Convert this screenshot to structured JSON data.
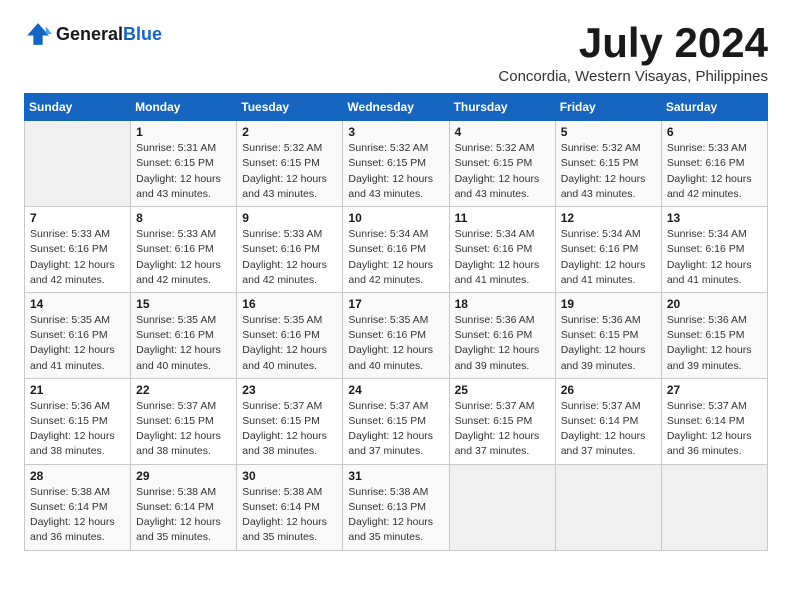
{
  "header": {
    "logo_general": "General",
    "logo_blue": "Blue",
    "month_year": "July 2024",
    "location": "Concordia, Western Visayas, Philippines"
  },
  "days_of_week": [
    "Sunday",
    "Monday",
    "Tuesday",
    "Wednesday",
    "Thursday",
    "Friday",
    "Saturday"
  ],
  "weeks": [
    [
      {
        "day": "",
        "sunrise": "",
        "sunset": "",
        "daylight": ""
      },
      {
        "day": "1",
        "sunrise": "Sunrise: 5:31 AM",
        "sunset": "Sunset: 6:15 PM",
        "daylight": "Daylight: 12 hours and 43 minutes."
      },
      {
        "day": "2",
        "sunrise": "Sunrise: 5:32 AM",
        "sunset": "Sunset: 6:15 PM",
        "daylight": "Daylight: 12 hours and 43 minutes."
      },
      {
        "day": "3",
        "sunrise": "Sunrise: 5:32 AM",
        "sunset": "Sunset: 6:15 PM",
        "daylight": "Daylight: 12 hours and 43 minutes."
      },
      {
        "day": "4",
        "sunrise": "Sunrise: 5:32 AM",
        "sunset": "Sunset: 6:15 PM",
        "daylight": "Daylight: 12 hours and 43 minutes."
      },
      {
        "day": "5",
        "sunrise": "Sunrise: 5:32 AM",
        "sunset": "Sunset: 6:15 PM",
        "daylight": "Daylight: 12 hours and 43 minutes."
      },
      {
        "day": "6",
        "sunrise": "Sunrise: 5:33 AM",
        "sunset": "Sunset: 6:16 PM",
        "daylight": "Daylight: 12 hours and 42 minutes."
      }
    ],
    [
      {
        "day": "7",
        "sunrise": "Sunrise: 5:33 AM",
        "sunset": "Sunset: 6:16 PM",
        "daylight": "Daylight: 12 hours and 42 minutes."
      },
      {
        "day": "8",
        "sunrise": "Sunrise: 5:33 AM",
        "sunset": "Sunset: 6:16 PM",
        "daylight": "Daylight: 12 hours and 42 minutes."
      },
      {
        "day": "9",
        "sunrise": "Sunrise: 5:33 AM",
        "sunset": "Sunset: 6:16 PM",
        "daylight": "Daylight: 12 hours and 42 minutes."
      },
      {
        "day": "10",
        "sunrise": "Sunrise: 5:34 AM",
        "sunset": "Sunset: 6:16 PM",
        "daylight": "Daylight: 12 hours and 42 minutes."
      },
      {
        "day": "11",
        "sunrise": "Sunrise: 5:34 AM",
        "sunset": "Sunset: 6:16 PM",
        "daylight": "Daylight: 12 hours and 41 minutes."
      },
      {
        "day": "12",
        "sunrise": "Sunrise: 5:34 AM",
        "sunset": "Sunset: 6:16 PM",
        "daylight": "Daylight: 12 hours and 41 minutes."
      },
      {
        "day": "13",
        "sunrise": "Sunrise: 5:34 AM",
        "sunset": "Sunset: 6:16 PM",
        "daylight": "Daylight: 12 hours and 41 minutes."
      }
    ],
    [
      {
        "day": "14",
        "sunrise": "Sunrise: 5:35 AM",
        "sunset": "Sunset: 6:16 PM",
        "daylight": "Daylight: 12 hours and 41 minutes."
      },
      {
        "day": "15",
        "sunrise": "Sunrise: 5:35 AM",
        "sunset": "Sunset: 6:16 PM",
        "daylight": "Daylight: 12 hours and 40 minutes."
      },
      {
        "day": "16",
        "sunrise": "Sunrise: 5:35 AM",
        "sunset": "Sunset: 6:16 PM",
        "daylight": "Daylight: 12 hours and 40 minutes."
      },
      {
        "day": "17",
        "sunrise": "Sunrise: 5:35 AM",
        "sunset": "Sunset: 6:16 PM",
        "daylight": "Daylight: 12 hours and 40 minutes."
      },
      {
        "day": "18",
        "sunrise": "Sunrise: 5:36 AM",
        "sunset": "Sunset: 6:16 PM",
        "daylight": "Daylight: 12 hours and 39 minutes."
      },
      {
        "day": "19",
        "sunrise": "Sunrise: 5:36 AM",
        "sunset": "Sunset: 6:15 PM",
        "daylight": "Daylight: 12 hours and 39 minutes."
      },
      {
        "day": "20",
        "sunrise": "Sunrise: 5:36 AM",
        "sunset": "Sunset: 6:15 PM",
        "daylight": "Daylight: 12 hours and 39 minutes."
      }
    ],
    [
      {
        "day": "21",
        "sunrise": "Sunrise: 5:36 AM",
        "sunset": "Sunset: 6:15 PM",
        "daylight": "Daylight: 12 hours and 38 minutes."
      },
      {
        "day": "22",
        "sunrise": "Sunrise: 5:37 AM",
        "sunset": "Sunset: 6:15 PM",
        "daylight": "Daylight: 12 hours and 38 minutes."
      },
      {
        "day": "23",
        "sunrise": "Sunrise: 5:37 AM",
        "sunset": "Sunset: 6:15 PM",
        "daylight": "Daylight: 12 hours and 38 minutes."
      },
      {
        "day": "24",
        "sunrise": "Sunrise: 5:37 AM",
        "sunset": "Sunset: 6:15 PM",
        "daylight": "Daylight: 12 hours and 37 minutes."
      },
      {
        "day": "25",
        "sunrise": "Sunrise: 5:37 AM",
        "sunset": "Sunset: 6:15 PM",
        "daylight": "Daylight: 12 hours and 37 minutes."
      },
      {
        "day": "26",
        "sunrise": "Sunrise: 5:37 AM",
        "sunset": "Sunset: 6:14 PM",
        "daylight": "Daylight: 12 hours and 37 minutes."
      },
      {
        "day": "27",
        "sunrise": "Sunrise: 5:37 AM",
        "sunset": "Sunset: 6:14 PM",
        "daylight": "Daylight: 12 hours and 36 minutes."
      }
    ],
    [
      {
        "day": "28",
        "sunrise": "Sunrise: 5:38 AM",
        "sunset": "Sunset: 6:14 PM",
        "daylight": "Daylight: 12 hours and 36 minutes."
      },
      {
        "day": "29",
        "sunrise": "Sunrise: 5:38 AM",
        "sunset": "Sunset: 6:14 PM",
        "daylight": "Daylight: 12 hours and 35 minutes."
      },
      {
        "day": "30",
        "sunrise": "Sunrise: 5:38 AM",
        "sunset": "Sunset: 6:14 PM",
        "daylight": "Daylight: 12 hours and 35 minutes."
      },
      {
        "day": "31",
        "sunrise": "Sunrise: 5:38 AM",
        "sunset": "Sunset: 6:13 PM",
        "daylight": "Daylight: 12 hours and 35 minutes."
      },
      {
        "day": "",
        "sunrise": "",
        "sunset": "",
        "daylight": ""
      },
      {
        "day": "",
        "sunrise": "",
        "sunset": "",
        "daylight": ""
      },
      {
        "day": "",
        "sunrise": "",
        "sunset": "",
        "daylight": ""
      }
    ]
  ]
}
